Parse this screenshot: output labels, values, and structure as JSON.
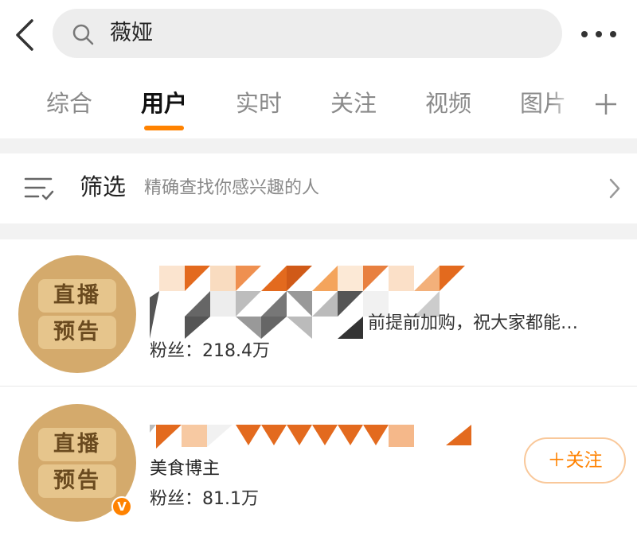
{
  "search": {
    "query": "薇娅"
  },
  "tabs": [
    {
      "label": "综合"
    },
    {
      "label": "用户"
    },
    {
      "label": "实时"
    },
    {
      "label": "关注"
    },
    {
      "label": "视频"
    },
    {
      "label": "图片"
    }
  ],
  "filter": {
    "title": "筛选",
    "description": "精确查找你感兴趣的人"
  },
  "results": [
    {
      "avatar_badge_top": "直播",
      "avatar_badge_bottom": "预告",
      "description": "前提前加购，祝大家都能…",
      "fans": "粉丝：218.4万",
      "verified": false
    },
    {
      "avatar_badge_top": "直播",
      "avatar_badge_bottom": "预告",
      "description": "美食博主",
      "fans": "粉丝：81.1万",
      "verified": true,
      "verified_mark": "V",
      "follow_label": "＋关注"
    }
  ],
  "colors": {
    "accent": "#ff8200",
    "avatar": "#d4aa6c",
    "background_gap": "#f2f2f2"
  },
  "icons": [
    "back-arrow-icon",
    "search-icon",
    "more-icon",
    "plus-icon",
    "filter-icon",
    "chevron-right-icon",
    "verified-badge-icon"
  ]
}
